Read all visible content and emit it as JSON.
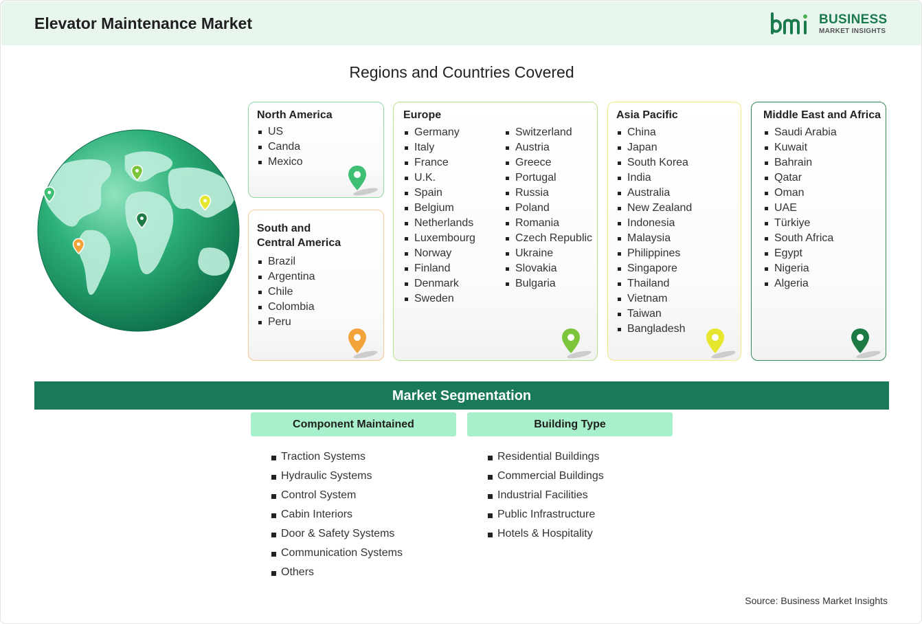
{
  "header": {
    "title": "Elevator Maintenance Market",
    "logo": {
      "line1": "BUSINESS",
      "line2": "MARKET INSIGHTS",
      "brand_color": "#1a7a4e"
    }
  },
  "regions": {
    "title": "Regions and Countries Covered",
    "north_america": {
      "name": "North America",
      "pin_color": "#3fbf74",
      "countries": [
        "US",
        "Canda",
        "Mexico"
      ]
    },
    "south_central_america": {
      "name_line1": "South and",
      "name_line2": "Central America",
      "pin_color": "#f2a33a",
      "countries": [
        "Brazil",
        "Argentina",
        "Chile",
        "Colombia",
        "Peru"
      ]
    },
    "europe": {
      "name": "Europe",
      "pin_color": "#7cc43a",
      "col1": [
        "Germany",
        "Italy",
        "France",
        "U.K.",
        "Spain",
        "Belgium",
        "Netherlands",
        "Luxembourg",
        "Norway",
        "Finland",
        "Denmark",
        "Sweden"
      ],
      "col2": [
        "Switzerland",
        "Austria",
        "Greece",
        "Portugal",
        "Russia",
        "Poland",
        "Romania",
        "Czech Republic",
        "Ukraine",
        "Slovakia",
        "Bulgaria"
      ]
    },
    "asia_pacific": {
      "name": "Asia Pacific",
      "pin_color": "#e6e62e",
      "countries": [
        "China",
        "Japan",
        "South Korea",
        "India",
        "Australia",
        "New Zealand",
        "Indonesia",
        "Malaysia",
        "Philippines",
        "Singapore",
        "Thailand",
        "Vietnam",
        "Taiwan",
        "Bangladesh"
      ]
    },
    "middle_east_africa": {
      "name": "Middle East and Africa",
      "pin_color": "#1e7a44",
      "countries": [
        "Saudi Arabia",
        "Kuwait",
        "Bahrain",
        "Qatar",
        "Oman",
        "UAE",
        "Türkiye",
        "South Africa",
        "Egypt",
        "Nigeria",
        "Algeria"
      ]
    }
  },
  "segmentation": {
    "title": "Market Segmentation",
    "bar_color": "#1a7a57",
    "component": {
      "heading": "Component Maintained",
      "items": [
        "Traction Systems",
        "Hydraulic Systems",
        "Control System",
        "Cabin Interiors",
        "Door & Safety Systems",
        "Communication Systems",
        "Others"
      ]
    },
    "building": {
      "heading": "Building Type",
      "items": [
        "Residential Buildings",
        "Commercial Buildings",
        "Industrial Facilities",
        "Public Infrastructure",
        "Hotels & Hospitality"
      ]
    }
  },
  "source": "Source: Business Market Insights"
}
